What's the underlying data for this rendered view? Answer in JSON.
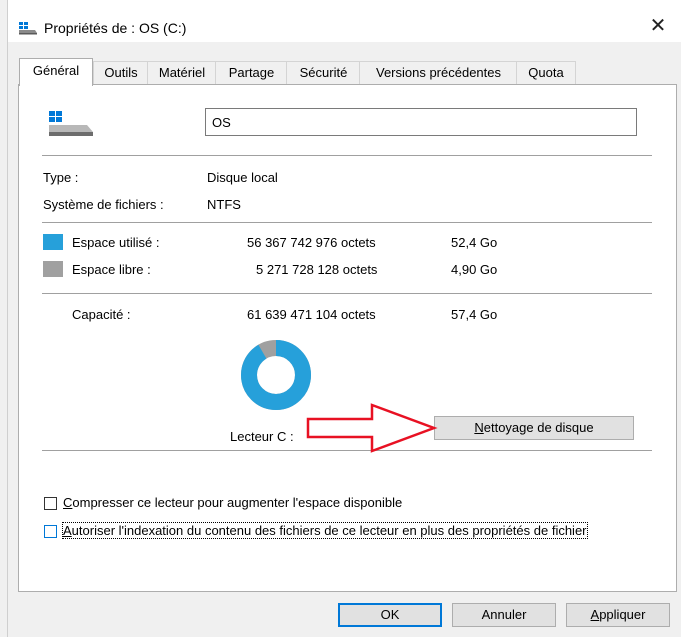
{
  "window": {
    "title": "Propriétés de : OS (C:)",
    "close_glyph": "✕"
  },
  "tabs": [
    {
      "label": "Général",
      "active": true
    },
    {
      "label": "Outils",
      "active": false
    },
    {
      "label": "Matériel",
      "active": false
    },
    {
      "label": "Partage",
      "active": false
    },
    {
      "label": "Sécurité",
      "active": false
    },
    {
      "label": "Versions précédentes",
      "active": false
    },
    {
      "label": "Quota",
      "active": false
    }
  ],
  "general": {
    "drive_name": "OS",
    "type_label": "Type :",
    "type_value": "Disque local",
    "fs_label": "Système de fichiers :",
    "fs_value": "NTFS",
    "used": {
      "label": "Espace utilisé :",
      "bytes": "56 367 742 976 octets",
      "size": "52,4 Go",
      "color": "#26a0da"
    },
    "free": {
      "label": "Espace libre :",
      "bytes": "5 271 728 128 octets",
      "size": "4,90 Go",
      "color": "#a0a0a0"
    },
    "capacity": {
      "label": "Capacité :",
      "bytes": "61 639 471 104 octets",
      "size": "57,4 Go"
    },
    "used_fraction": 0.9145,
    "drive_label": "Lecteur C :",
    "cleanup_button": {
      "underlined_char": "N",
      "rest": "ettoyage de disque"
    }
  },
  "options": {
    "compress": {
      "underlined_char": "C",
      "rest": "ompresser ce lecteur pour augmenter l'espace disponible",
      "checked": false
    },
    "index": {
      "underlined_char": "A",
      "rest": "utoriser l'indexation du contenu des fichiers de ce lecteur en plus des propriétés de fichier",
      "checked": false
    }
  },
  "footer": {
    "ok": "OK",
    "cancel": "Annuler",
    "apply": {
      "underlined_char": "A",
      "rest": "ppliquer"
    }
  },
  "icons": {
    "title": "drive-icon",
    "drive": "drive-icon",
    "close": "close-icon",
    "annotation": "red-arrow"
  },
  "colors": {
    "accent": "#0078d7",
    "used": "#26a0da",
    "free": "#a0a0a0",
    "annotation_arrow": "#e81123"
  }
}
